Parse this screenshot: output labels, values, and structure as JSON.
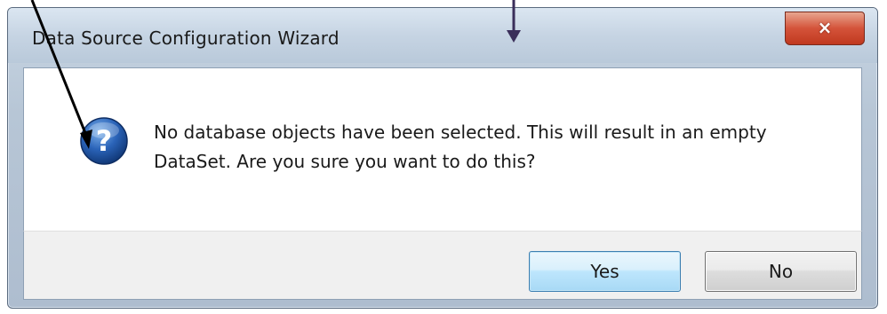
{
  "window": {
    "title": "Data Source Configuration Wizard",
    "close_icon": "×"
  },
  "dialog": {
    "icon": "question-icon",
    "message_line1": "No database objects have been selected.  This will result in an empty",
    "message_line2": "DataSet.  Are you sure you want to do this?"
  },
  "buttons": {
    "yes_label": "Yes",
    "no_label": "No"
  },
  "colors": {
    "icon_blue": "#1f4f9c",
    "annotation_arrow": "#3a2e5a"
  }
}
